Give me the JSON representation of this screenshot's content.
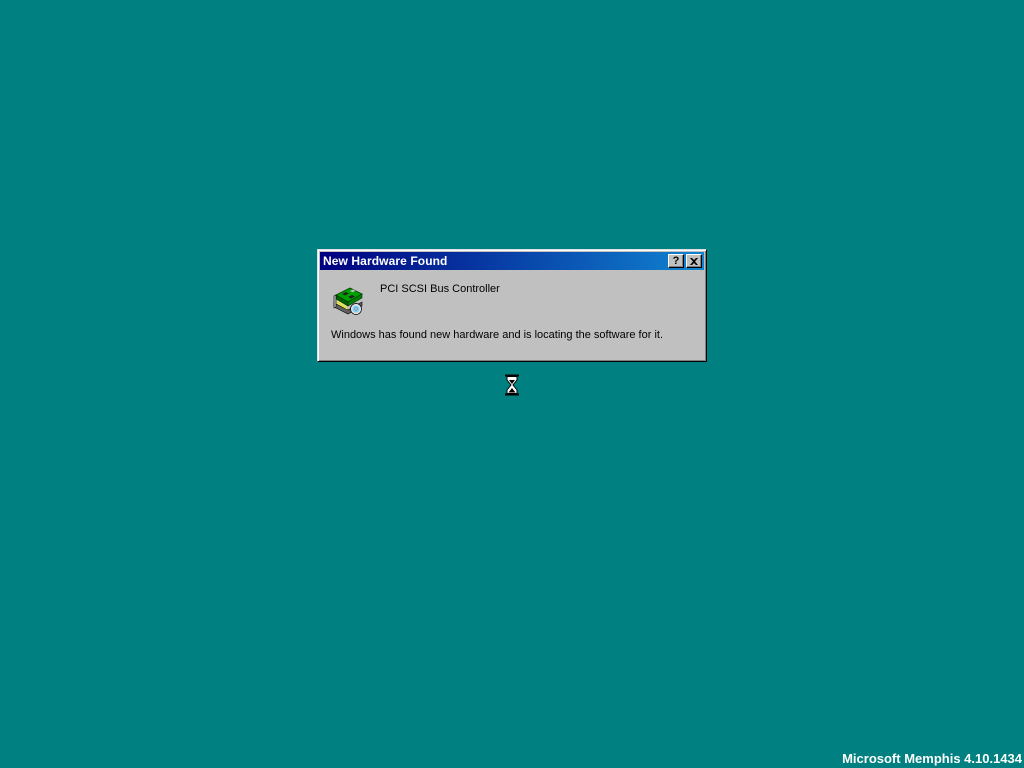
{
  "dialog": {
    "title": "New Hardware Found",
    "help_button": "?",
    "device_icon": "hardware-card-icon",
    "device_name": "PCI SCSI Bus Controller",
    "status": "Windows has found new hardware and is locating the software for it."
  },
  "cursor": {
    "icon": "hourglass-icon"
  },
  "desktop": {
    "background_color": "#008080",
    "build_string": "Microsoft Memphis 4.10.1434"
  },
  "colors": {
    "titlebar_start": "#000080",
    "titlebar_end": "#1084d0",
    "window_face": "#c0c0c0"
  }
}
